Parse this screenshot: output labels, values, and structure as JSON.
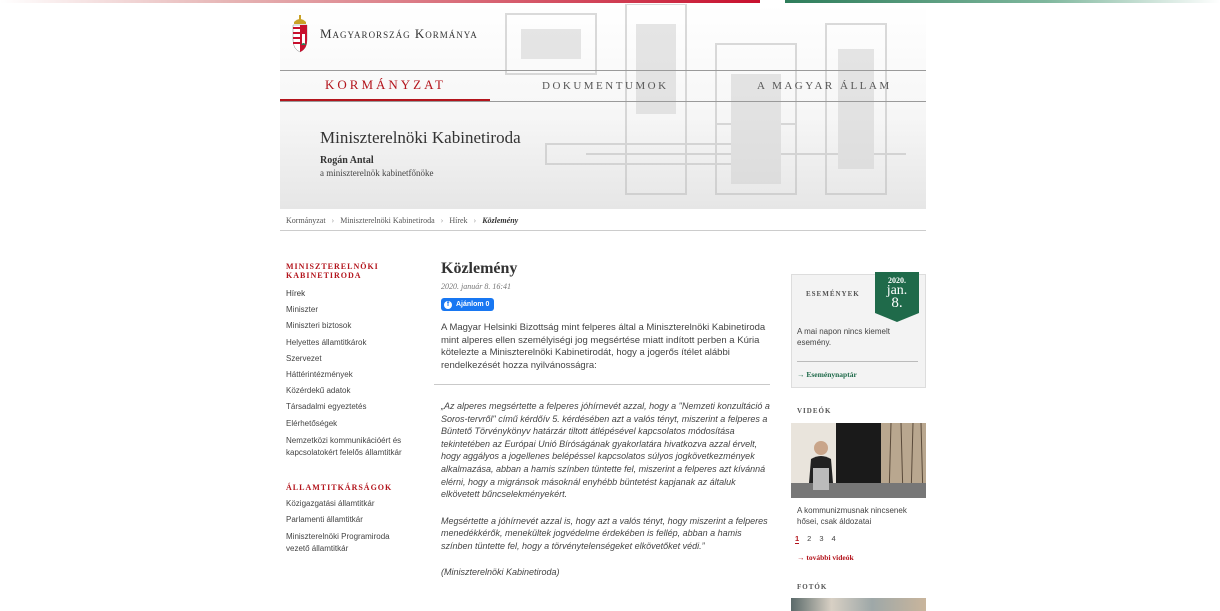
{
  "header": {
    "site_name": "Magyarország Kormánya",
    "nav": [
      {
        "label": "KORMÁNYZAT",
        "active": true
      },
      {
        "label": "DOKUMENTUMOK",
        "active": false
      },
      {
        "label": "A MAGYAR ÁLLAM",
        "active": false
      }
    ],
    "org_title": "Miniszterelnöki Kabinetiroda",
    "person": "Rogán Antal",
    "role": "a miniszterelnök kabinetfőnöke"
  },
  "breadcrumb": [
    "Kormányzat",
    "Miniszterelnöki Kabinetiroda",
    "Hírek",
    "Közlemény"
  ],
  "sidebar": {
    "section1_title_line1": "MINISZTERELNÖKI",
    "section1_title_line2": "KABINETIRODA",
    "section1_links": [
      "Hírek",
      "Miniszter",
      "Miniszteri biztosok",
      "Helyettes államtitkárok",
      "Szervezet",
      "Háttérintézmények",
      "Közérdekű adatok",
      "Társadalmi egyeztetés",
      "Elérhetőségek",
      "Nemzetközi kommunikációért és",
      "kapcsolatokért felelős államtitkár"
    ],
    "section2_title": "ÁLLAMTITKÁRSÁGOK",
    "section2_links": [
      "Közigazgatási államtitkár",
      "Parlamenti államtitkár",
      "Miniszterelnöki Programiroda",
      "vezető államtitkár"
    ]
  },
  "article": {
    "title": "Közlemény",
    "date": "2020. január 8. 16:41",
    "fb_button": "Ajánlom 0",
    "lead": "A Magyar Helsinki Bizottság mint felperes által a Miniszterelnöki Kabinetiroda mint alperes ellen személyiségi jog megsértése miatt indított perben a Kúria kötelezte a Miniszterelnöki Kabinetirodát, hogy a jogerős ítélet alábbi rendelkezését hozza nyilvánosságra:",
    "quote1": "„Az alperes megsértette a felperes jóhírnevét azzal, hogy a \"Nemzeti konzultáció a Soros-tervről\" című kérdőív 5. kérdésében azt a valós tényt, miszerint a felperes a Büntető Törvénykönyv határzár tiltott átlépésével kapcsolatos módosítása tekintetében az Európai Unió Bíróságának gyakorlatára hivatkozva azzal érvelt, hogy aggályos a jogellenes belépéssel kapcsolatos súlyos jogkövetkezmények alkalmazása, abban a hamis színben tüntette fel, miszerint a felperes azt kívánná elérni, hogy a migránsok másoknál enyhébb büntetést kapjanak az általuk elkövetett bűncselekményekért.",
    "quote2": "Megsértette a jóhírnevét azzal is, hogy azt a valós tényt, hogy miszerint a felperes menedékkérők, menekültek jogvédelme érdekében is fellép, abban a hamis színben tüntette fel, hogy a törvénytelenségeket elkövetőket védi.”",
    "signature": "(Miniszterelnöki Kabinetiroda)"
  },
  "events": {
    "title": "ESEMÉNYEK",
    "badge_year": "2020.",
    "badge_month": "jan.",
    "badge_day": "8.",
    "text": "A mai napon nincs kiemelt esemény.",
    "link": "→ Eseménynaptár"
  },
  "videos": {
    "title": "VIDEÓK",
    "caption": "A kommunizmusnak nincsenek hősei, csak áldozatai",
    "pages": [
      "1",
      "2",
      "3",
      "4"
    ],
    "more_link": "→ további videók"
  },
  "photos": {
    "title": "FOTÓK"
  },
  "colors": {
    "accent_red": "#b3141c",
    "accent_green": "#1f6a4a",
    "facebook_blue": "#1877f2"
  }
}
